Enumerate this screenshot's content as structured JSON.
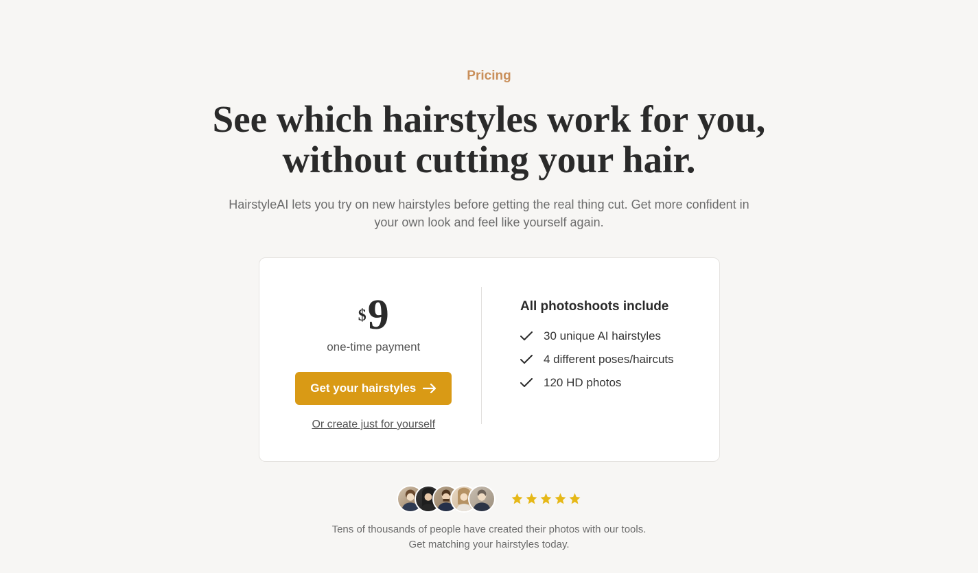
{
  "eyebrow": "Pricing",
  "headline": "See which hairstyles work for you, without cutting your hair.",
  "subhead": "HairstyleAI lets you try on new hairstyles before getting the real thing cut. Get more confident in your own look and feel like yourself again.",
  "pricing": {
    "currency": "$",
    "amount": "9",
    "note": "one-time payment",
    "cta_label": "Get your hairstyles",
    "alt_link": "Or create just for yourself"
  },
  "includes": {
    "title": "All photoshoots include",
    "items": [
      "30 unique AI hairstyles",
      "4 different poses/haircuts",
      "120 HD photos"
    ]
  },
  "social": {
    "text": "Tens of thousands of people have created their photos with our tools. Get matching your hairstyles today.",
    "star_count": 5,
    "avatar_count": 5
  },
  "colors": {
    "accent": "#d99a15",
    "eyebrow": "#c98f5a",
    "star": "#e6b817"
  }
}
